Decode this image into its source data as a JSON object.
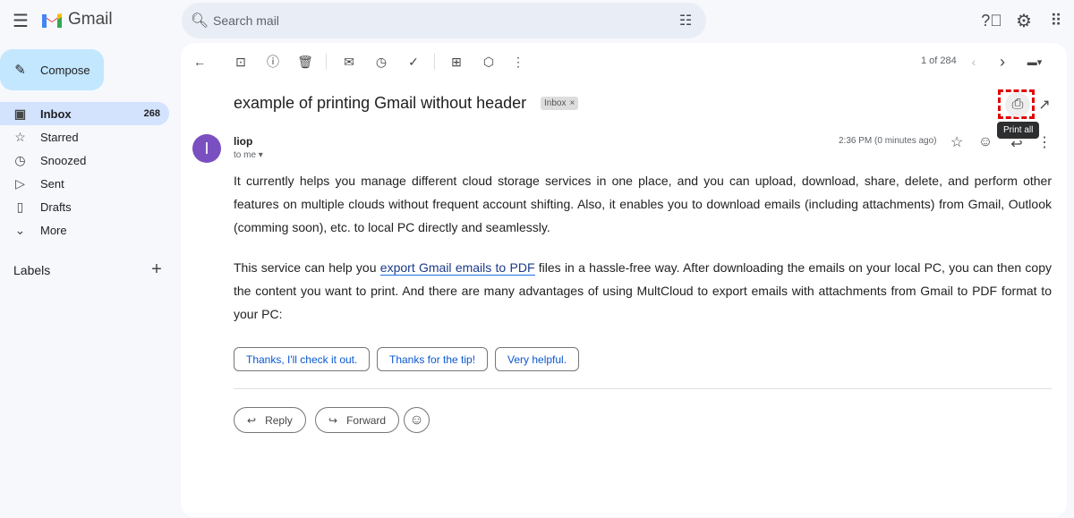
{
  "header": {
    "app_name": "Gmail",
    "search_placeholder": "Search mail"
  },
  "compose_label": "Compose",
  "sidebar": {
    "items": [
      {
        "label": "Inbox",
        "count": "268",
        "icon": "inbox-icon"
      },
      {
        "label": "Starred",
        "icon": "star-icon"
      },
      {
        "label": "Snoozed",
        "icon": "clock-icon"
      },
      {
        "label": "Sent",
        "icon": "send-icon"
      },
      {
        "label": "Drafts",
        "icon": "draft-icon"
      },
      {
        "label": "More",
        "icon": "chevron-down-icon"
      }
    ],
    "labels_heading": "Labels"
  },
  "toolbar": {
    "pagination": "1 of 284"
  },
  "email": {
    "subject": "example of printing Gmail without header",
    "label_chip": "Inbox",
    "label_close": "×",
    "avatar_letter": "I",
    "sender": "liop",
    "to": "to me",
    "time": "2:36 PM (0 minutes ago)",
    "tooltip": "Print all",
    "para1": "It currently helps you manage different cloud storage services in one place, and you can upload, download, share, delete, and perform other features on multiple clouds without frequent account shifting. Also, it enables you to download emails (including attachments) from Gmail, Outlook (comming soon), etc. to local PC directly and seamlessly.",
    "para2_before": "This service can help you ",
    "para2_link": "export Gmail emails to PDF",
    "para2_after": " files in a hassle-free way. After downloading the emails on your local PC, you can then copy the content you want to print. And there are many advantages of using MultCloud to export emails with attachments from Gmail to PDF format to your PC:"
  },
  "smart_replies": [
    "Thanks, I'll check it out.",
    "Thanks for the tip!",
    "Very helpful."
  ],
  "actions": {
    "reply": "Reply",
    "forward": "Forward"
  },
  "colors": {
    "accent": "#0b57d0",
    "highlight": "#e00000"
  }
}
